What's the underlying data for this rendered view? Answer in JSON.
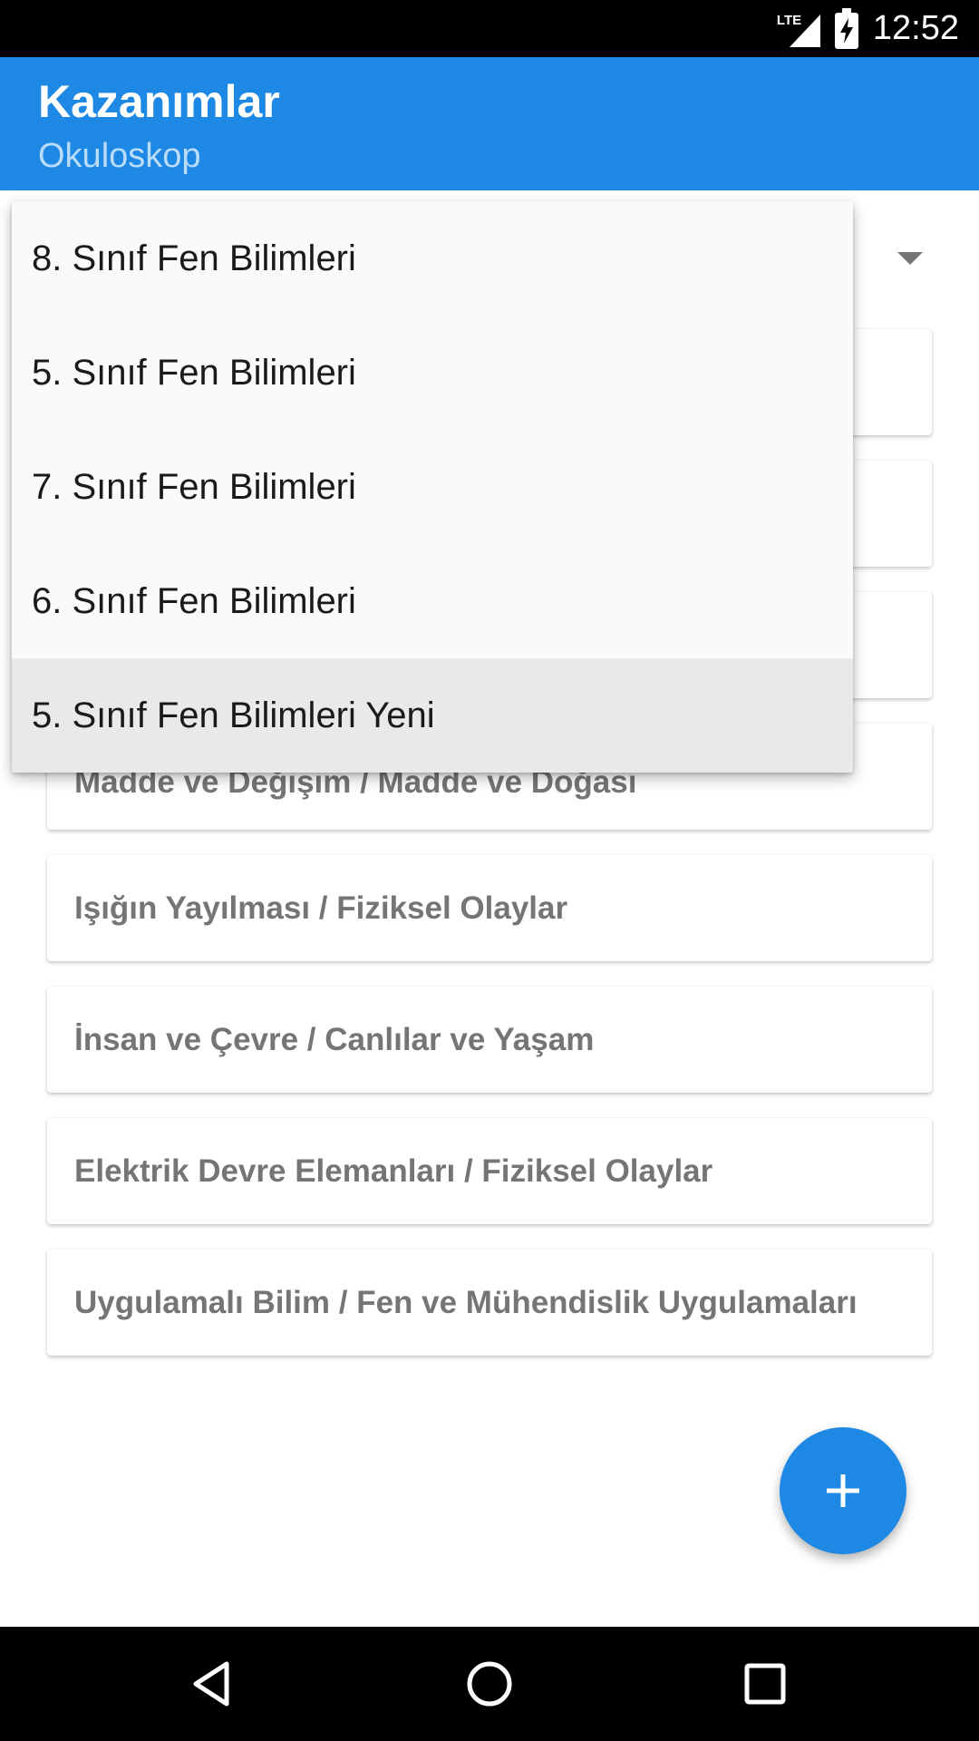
{
  "status_bar": {
    "network": "LTE",
    "time": "12:52"
  },
  "app_bar": {
    "title": "Kazanımlar",
    "subtitle": "Okuloskop"
  },
  "dropdown": {
    "options": [
      "8. Sınıf Fen Bilimleri",
      "5. Sınıf Fen Bilimleri",
      "7. Sınıf Fen Bilimleri",
      "6. Sınıf Fen Bilimleri",
      "5. Sınıf Fen Bilimleri Yeni"
    ],
    "selected_index": 4
  },
  "cards": [
    "",
    "",
    "",
    "Madde ve Değişim / Madde ve Doğası",
    "Işığın Yayılması / Fiziksel Olaylar",
    "İnsan ve Çevre / Canlılar ve Yaşam",
    "Elektrik Devre Elemanları / Fiziksel Olaylar",
    "Uygulamalı Bilim / Fen ve Mühendislik Uygulamaları"
  ],
  "icons": {
    "fab": "plus-icon",
    "nav_back": "back-triangle-icon",
    "nav_home": "home-circle-icon",
    "nav_recents": "recents-square-icon",
    "spinner": "dropdown-arrow-icon"
  },
  "colors": {
    "primary": "#1e88e5",
    "subtitle": "#b9dcfb",
    "card_text": "#757575",
    "selected_item_bg": "#e9e9e9"
  }
}
